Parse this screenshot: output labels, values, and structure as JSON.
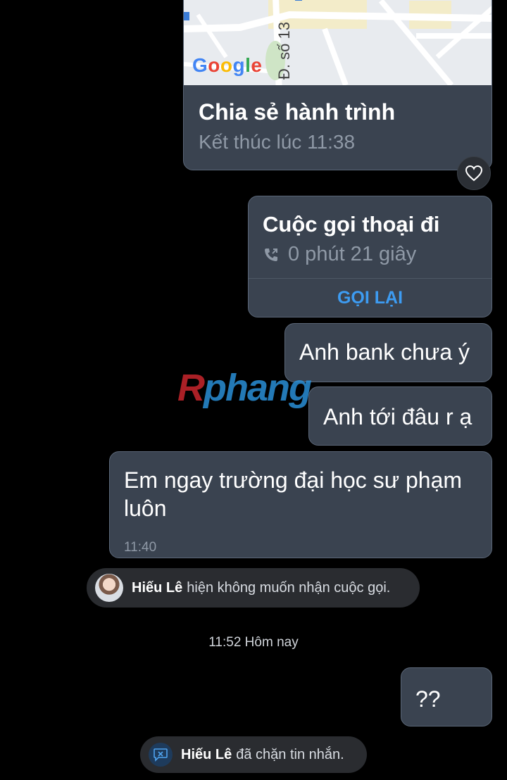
{
  "map_card": {
    "logo": "Google",
    "road_label": "Đ. số 13",
    "title": "Chia sẻ hành trình",
    "subtitle": "Kết thúc lúc 11:38"
  },
  "reaction": {
    "icon": "heart-icon"
  },
  "call_card": {
    "title": "Cuộc gọi thoại đi",
    "duration": "0 phút 21 giây",
    "callback_label": "GỌI LẠI",
    "icon": "phone-outgoing-icon"
  },
  "messages": [
    {
      "text": "Anh bank chưa ý"
    },
    {
      "text": "Anh tới đâu r ạ"
    },
    {
      "text": "Em ngay trường đại học sư phạm luôn",
      "time": "11:40"
    },
    {
      "text": "??"
    }
  ],
  "system_call": {
    "name": "Hiếu Lê",
    "text": "hiện không muốn nhận cuộc gọi."
  },
  "timestamp": "11:52 Hôm nay",
  "system_block": {
    "name": "Hiếu Lê",
    "text": "đã chặn tin nhắn."
  },
  "watermark": {
    "first": "R",
    "rest": "phang"
  },
  "colors": {
    "bubble": "#3a4350",
    "accent": "#3d9cf2",
    "background": "#000000"
  }
}
